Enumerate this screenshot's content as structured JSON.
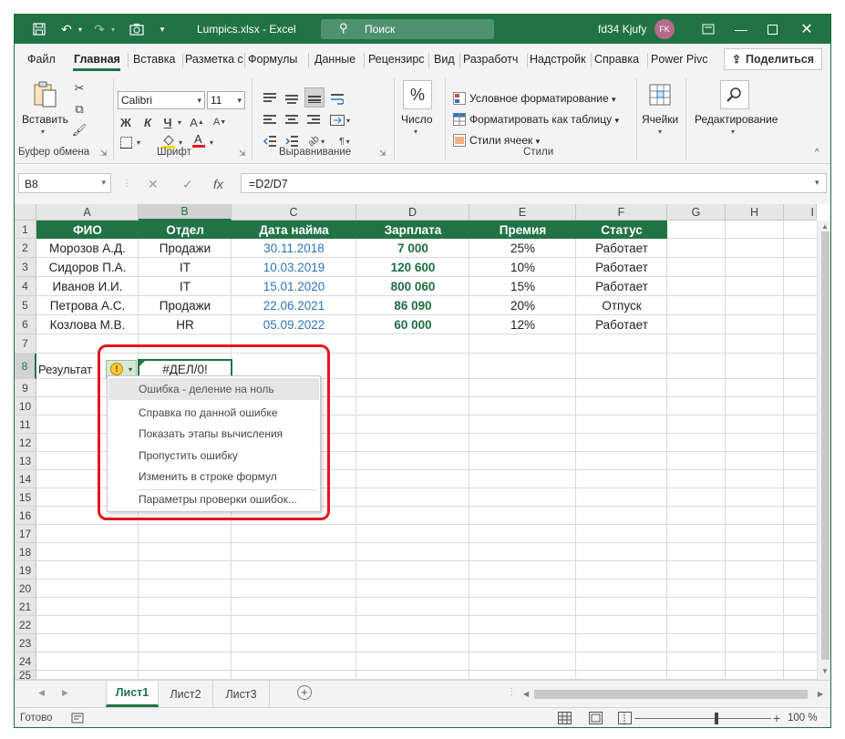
{
  "window": {
    "title": "Lumpics.xlsx  -  Excel",
    "search_placeholder": "Поиск",
    "user_name": "fd34 Kjufy",
    "avatar_initials": "FK",
    "accent_color": "#217346"
  },
  "tabs": [
    {
      "label": "Файл",
      "active": false
    },
    {
      "label": "Главная",
      "active": true
    },
    {
      "label": "Вставка",
      "active": false
    },
    {
      "label": "Разметка с",
      "active": false
    },
    {
      "label": "Формулы",
      "active": false
    },
    {
      "label": "Данные",
      "active": false
    },
    {
      "label": "Рецензирс",
      "active": false
    },
    {
      "label": "Вид",
      "active": false
    },
    {
      "label": "Разработч",
      "active": false
    },
    {
      "label": "Надстройк",
      "active": false
    },
    {
      "label": "Справка",
      "active": false
    },
    {
      "label": "Power Pivc",
      "active": false
    }
  ],
  "share_label": "Поделиться",
  "ribbon": {
    "paste_label": "Вставить",
    "clipboard_group": "Буфер обмена",
    "font_name": "Calibri",
    "font_size": "11",
    "font_group": "Шрифт",
    "alignment_group": "Выравнивание",
    "number_label": "Число",
    "cond_format": "Условное форматирование",
    "format_table": "Форматировать как таблицу",
    "cell_styles": "Стили ячеек",
    "styles_group": "Стили",
    "cells_label": "Ячейки",
    "editing_label": "Редактирование"
  },
  "formula_bar": {
    "name_box": "B8",
    "formula": "=D2/D7"
  },
  "columns": [
    "A",
    "B",
    "C",
    "D",
    "E",
    "F",
    "G",
    "H",
    "I"
  ],
  "selected_column": "B",
  "rows": [
    "1",
    "2",
    "3",
    "4",
    "5",
    "6",
    "7",
    "8",
    "9",
    "10",
    "11",
    "12",
    "13",
    "14",
    "15",
    "16",
    "17",
    "18",
    "19",
    "20",
    "21",
    "22",
    "23",
    "24",
    "25"
  ],
  "selected_row": "8",
  "table": {
    "headers": [
      "ФИО",
      "Отдел",
      "Дата найма",
      "Зарплата",
      "Премия",
      "Статус"
    ],
    "rows": [
      [
        "Морозов А.Д.",
        "Продажи",
        "30.11.2018",
        "7 000",
        "25%",
        "Работает"
      ],
      [
        "Сидоров П.А.",
        "IT",
        "10.03.2019",
        "120 600",
        "10%",
        "Работает"
      ],
      [
        "Иванов И.И.",
        "IT",
        "15.01.2020",
        "800 060",
        "15%",
        "Работает"
      ],
      [
        "Петрова А.С.",
        "Продажи",
        "22.06.2021",
        "86 090",
        "20%",
        "Отпуск"
      ],
      [
        "Козлова М.В.",
        "HR",
        "05.09.2022",
        "60 000",
        "12%",
        "Работает"
      ]
    ]
  },
  "result_label": "Результат",
  "error_value": "#ДЕЛ/0!",
  "error_menu": {
    "header": "Ошибка  - деление на ноль",
    "items": [
      "Справка по данной ошибке",
      "Показать этапы вычисления",
      "Пропустить ошибку",
      "Изменить в строке формул",
      "Параметры проверки ошибок..."
    ]
  },
  "sheets": [
    {
      "label": "Лист1",
      "active": true
    },
    {
      "label": "Лист2",
      "active": false
    },
    {
      "label": "Лист3",
      "active": false
    }
  ],
  "status": {
    "text": "Готово",
    "zoom": "100 %"
  }
}
